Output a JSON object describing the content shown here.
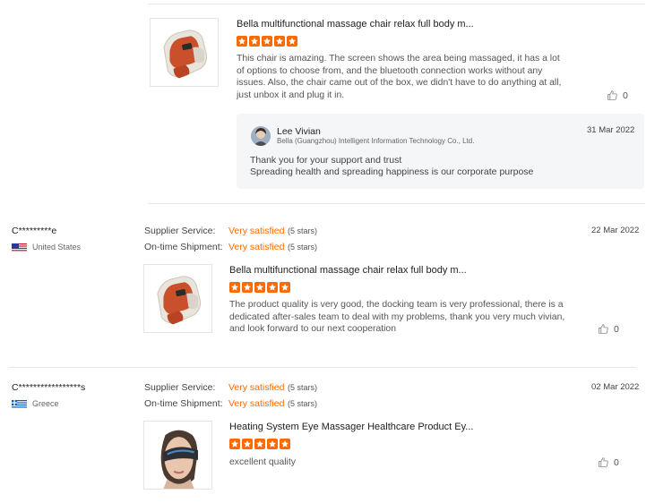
{
  "review1": {
    "product_title": "Bella multifunctional massage chair relax full body m...",
    "rating": 5,
    "text": "This chair is amazing. The screen shows the area being massaged, it has a lot of options to choose from, and the bluetooth connection works without any issues. Also, the chair came out of the box, we didn't have to do anything at all, just unbox it and plug it in.",
    "likes": "0",
    "product_icon": "massage-chair-image",
    "reply": {
      "name": "Lee Vivian",
      "company": "Bella (Guangzhou) Intelligent Information Technology Co., Ltd.",
      "date": "31 Mar 2022",
      "line1": "Thank you for your support and trust",
      "line2": "Spreading health and spreading happiness is our corporate purpose"
    }
  },
  "review2": {
    "user": "C*********e",
    "country": "United States",
    "flag": "us-flag-icon",
    "supplier_label": "Supplier Service:",
    "supplier_value": "Very satisfied",
    "supplier_stars": "(5 stars)",
    "shipment_label": "On-time Shipment:",
    "shipment_value": "Very satisfied",
    "shipment_stars": "(5 stars)",
    "date": "22 Mar 2022",
    "product_title": "Bella multifunctional massage chair relax full body m...",
    "rating": 5,
    "text": "The product quality is very good, the docking team is very professional, there is a dedicated after-sales team to deal with my problems, thank you very much vivian, and look forward to our next cooperation",
    "likes": "0",
    "product_icon": "massage-chair-image"
  },
  "review3": {
    "user": "C*****************s",
    "country": "Greece",
    "flag": "greece-flag-icon",
    "supplier_label": "Supplier Service:",
    "supplier_value": "Very satisfied",
    "supplier_stars": "(5 stars)",
    "shipment_label": "On-time Shipment:",
    "shipment_value": "Very satisfied",
    "shipment_stars": "(5 stars)",
    "date": "02 Mar 2022",
    "product_title": "Heating System Eye Massager Healthcare Product Ey...",
    "rating": 5,
    "text": "excellent quality",
    "likes": "0",
    "product_icon": "eye-massager-image"
  },
  "colors": {
    "accent": "#ff6a00",
    "reply_bg": "#f5f6f8",
    "divider": "#e6e6e6"
  }
}
